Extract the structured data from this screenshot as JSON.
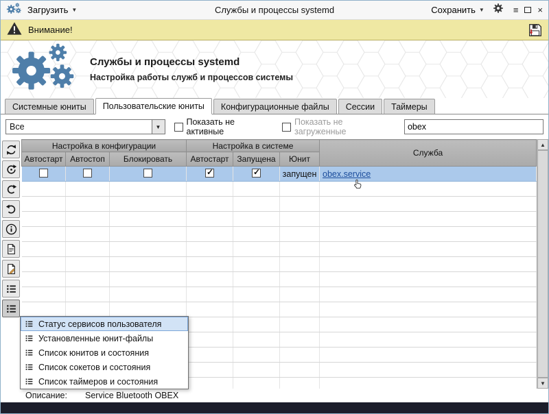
{
  "titlebar": {
    "load_label": "Загрузить",
    "title": "Службы и процессы systemd",
    "save_label": "Сохранить"
  },
  "warning": {
    "label": "Внимание!"
  },
  "header": {
    "title": "Службы и процессы systemd",
    "subtitle": "Настройка работы служб и процессов системы"
  },
  "tabs": [
    {
      "label": "Системные юниты",
      "active": false
    },
    {
      "label": "Пользовательские юниты",
      "active": true
    },
    {
      "label": "Конфигурационные файлы",
      "active": false
    },
    {
      "label": "Сессии",
      "active": false
    },
    {
      "label": "Таймеры",
      "active": false
    }
  ],
  "filters": {
    "scope_value": "Все",
    "show_inactive_label": "Показать не активные",
    "show_inactive": false,
    "show_unloaded_label": "Показать не загруженные",
    "show_unloaded": false,
    "show_unloaded_disabled": true,
    "search_value": "obex"
  },
  "table": {
    "groups": {
      "config": "Настройка в конфигурации",
      "system": "Настройка в системе",
      "service": "Служба"
    },
    "columns": [
      "Автостарт",
      "Автостоп",
      "Блокировать",
      "Автостарт",
      "Запущена",
      "Юнит"
    ],
    "rows": [
      {
        "config_autostart": false,
        "config_autostop": false,
        "config_block": false,
        "system_autostart": true,
        "system_running": true,
        "unit_state": "запущен",
        "service": "obex.service",
        "selected": true
      }
    ]
  },
  "toolbar_icons": [
    "refresh-icon",
    "restart-icon",
    "redo-icon",
    "undo-icon",
    "info-icon",
    "file-icon",
    "file-edit-icon",
    "list-icon",
    "status-list-icon"
  ],
  "menu": {
    "items": [
      {
        "label": "Статус сервисов пользователя",
        "selected": true
      },
      {
        "label": "Установленные юнит-файлы",
        "selected": false
      },
      {
        "label": "Список юнитов и состояния",
        "selected": false
      },
      {
        "label": "Список сокетов и состояния",
        "selected": false
      },
      {
        "label": "Список таймеров и состояния",
        "selected": false
      }
    ]
  },
  "statusbar": {
    "label": "Описание:",
    "value": "Service Bluetooth OBEX"
  },
  "colors": {
    "warning_bg": "#efe8a3",
    "selected_row": "#abc9eb",
    "link": "#1b4c9c",
    "gear_accent": "#4e7ea9",
    "table_header": "#b2b2b2",
    "bottom_bar": "#1c1e2b"
  }
}
